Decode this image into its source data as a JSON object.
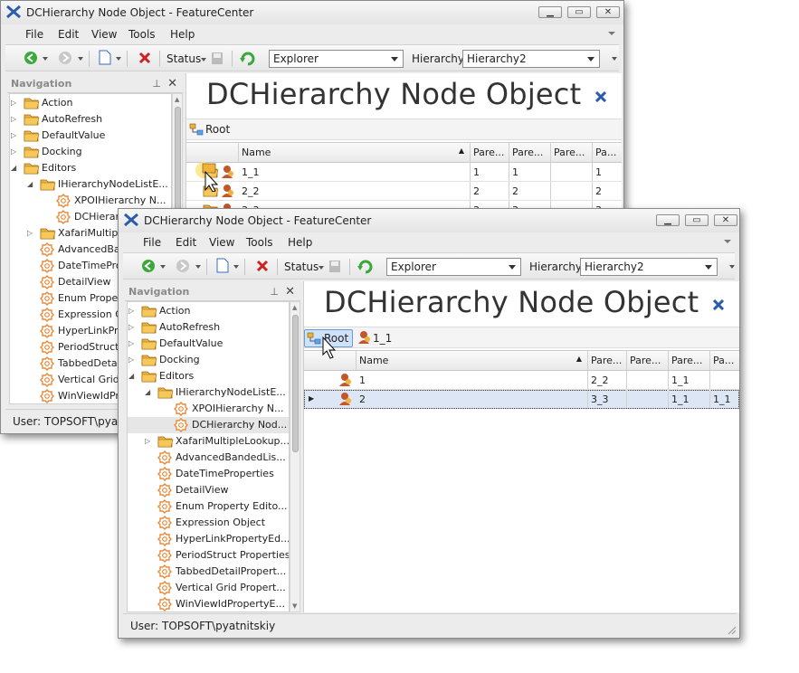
{
  "back_window": {
    "title": "DCHierarchy Node Object - FeatureCenter",
    "menu": [
      "File",
      "Edit",
      "View",
      "Tools",
      "Help"
    ],
    "toolbar": {
      "status_label": "Status",
      "view_combo": "Explorer",
      "hierarchy_label": "Hierarchy",
      "hierarchy_combo": "Hierarchy2"
    },
    "navigation": {
      "title": "Navigation",
      "items": [
        {
          "label": "Action",
          "level": 0,
          "icon": "folder-icon",
          "expander": "collapsed"
        },
        {
          "label": "AutoRefresh",
          "level": 0,
          "icon": "folder-icon",
          "expander": "collapsed"
        },
        {
          "label": "DefaultValue",
          "level": 0,
          "icon": "folder-icon",
          "expander": "collapsed"
        },
        {
          "label": "Docking",
          "level": 0,
          "icon": "folder-icon",
          "expander": "collapsed"
        },
        {
          "label": "Editors",
          "level": 0,
          "icon": "folder-icon",
          "expander": "expanded"
        },
        {
          "label": "IHierarchyNodeListE...",
          "level": 1,
          "icon": "folder-icon",
          "expander": "expanded"
        },
        {
          "label": "XPOIHierarchy N...",
          "level": 2,
          "icon": "gear-icon",
          "expander": ""
        },
        {
          "label": "DCHierarc",
          "level": 2,
          "icon": "gear-icon",
          "expander": ""
        },
        {
          "label": "XafariMultiple",
          "level": 1,
          "icon": "folder-icon",
          "expander": "collapsed"
        },
        {
          "label": "AdvancedBan",
          "level": 1,
          "icon": "gear-icon",
          "expander": ""
        },
        {
          "label": "DateTimeProp",
          "level": 1,
          "icon": "gear-icon",
          "expander": ""
        },
        {
          "label": "DetailView",
          "level": 1,
          "icon": "gear-icon",
          "expander": ""
        },
        {
          "label": "Enum Propert",
          "level": 1,
          "icon": "gear-icon",
          "expander": ""
        },
        {
          "label": "Expression O",
          "level": 1,
          "icon": "gear-icon",
          "expander": ""
        },
        {
          "label": "HyperLinkPro",
          "level": 1,
          "icon": "gear-icon",
          "expander": ""
        },
        {
          "label": "PeriodStruct P",
          "level": 1,
          "icon": "gear-icon",
          "expander": ""
        },
        {
          "label": "TabbedDetail",
          "level": 1,
          "icon": "gear-icon",
          "expander": ""
        },
        {
          "label": "Vertical Grid P",
          "level": 1,
          "icon": "gear-icon",
          "expander": ""
        },
        {
          "label": "WinViewIdPro",
          "level": 1,
          "icon": "gear-icon",
          "expander": ""
        }
      ]
    },
    "status_text": "User: TOPSOFT\\pyatn",
    "view_title": "DCHierarchy Node Object",
    "breadcrumb": [
      "Root"
    ],
    "grid": {
      "columns": [
        "Name",
        "Pare...",
        "Pare...",
        "Pare...",
        "Pa..."
      ],
      "rows": [
        {
          "name": "1_1",
          "c1": "1",
          "c2": "1",
          "c3": "",
          "c4": "1"
        },
        {
          "name": "2_2",
          "c1": "2",
          "c2": "2",
          "c3": "",
          "c4": "2"
        },
        {
          "name": "3_3",
          "c1": "3",
          "c2": "3",
          "c3": "",
          "c4": "3"
        }
      ]
    }
  },
  "front_window": {
    "title": "DCHierarchy Node Object - FeatureCenter",
    "menu": [
      "File",
      "Edit",
      "View",
      "Tools",
      "Help"
    ],
    "toolbar": {
      "status_label": "Status",
      "view_combo": "Explorer",
      "hierarchy_label": "Hierarchy",
      "hierarchy_combo": "Hierarchy2"
    },
    "navigation": {
      "title": "Navigation",
      "items": [
        {
          "label": "Action",
          "level": 0,
          "icon": "folder-icon",
          "expander": "collapsed"
        },
        {
          "label": "AutoRefresh",
          "level": 0,
          "icon": "folder-icon",
          "expander": "collapsed"
        },
        {
          "label": "DefaultValue",
          "level": 0,
          "icon": "folder-icon",
          "expander": "collapsed"
        },
        {
          "label": "Docking",
          "level": 0,
          "icon": "folder-icon",
          "expander": "collapsed"
        },
        {
          "label": "Editors",
          "level": 0,
          "icon": "folder-icon",
          "expander": "expanded"
        },
        {
          "label": "IHierarchyNodeListE...",
          "level": 1,
          "icon": "folder-icon",
          "expander": "expanded"
        },
        {
          "label": "XPOIHierarchy N...",
          "level": 2,
          "icon": "gear-icon",
          "expander": ""
        },
        {
          "label": "DCHierarchy Nod...",
          "level": 2,
          "icon": "gear-icon",
          "expander": "",
          "selected": true
        },
        {
          "label": "XafariMultipleLookup...",
          "level": 1,
          "icon": "folder-icon",
          "expander": "collapsed"
        },
        {
          "label": "AdvancedBandedLis...",
          "level": 1,
          "icon": "gear-icon",
          "expander": ""
        },
        {
          "label": "DateTimeProperties",
          "level": 1,
          "icon": "gear-icon",
          "expander": ""
        },
        {
          "label": "DetailView",
          "level": 1,
          "icon": "gear-icon",
          "expander": ""
        },
        {
          "label": "Enum Property Edito...",
          "level": 1,
          "icon": "gear-icon",
          "expander": ""
        },
        {
          "label": "Expression Object",
          "level": 1,
          "icon": "gear-icon",
          "expander": ""
        },
        {
          "label": "HyperLinkPropertyEd...",
          "level": 1,
          "icon": "gear-icon",
          "expander": ""
        },
        {
          "label": "PeriodStruct Properties",
          "level": 1,
          "icon": "gear-icon",
          "expander": ""
        },
        {
          "label": "TabbedDetailPropert...",
          "level": 1,
          "icon": "gear-icon",
          "expander": ""
        },
        {
          "label": "Vertical Grid Propert...",
          "level": 1,
          "icon": "gear-icon",
          "expander": ""
        },
        {
          "label": "WinViewIdPropertyE...",
          "level": 1,
          "icon": "gear-icon",
          "expander": ""
        }
      ]
    },
    "status_text": "User: TOPSOFT\\pyatnitskiy",
    "view_title": "DCHierarchy Node Object",
    "breadcrumb": [
      "Root",
      "1_1"
    ],
    "grid": {
      "columns": [
        "Name",
        "Pare...",
        "Pare...",
        "Pare...",
        "Pa..."
      ],
      "rows": [
        {
          "name": "1",
          "c1": "2_2",
          "c2": "",
          "c3": "1_1",
          "c4": ""
        },
        {
          "name": "2",
          "c1": "3_3",
          "c2": "",
          "c3": "1_1",
          "c4": "1_1",
          "selected": true
        }
      ]
    }
  },
  "colors": {
    "folder": "#f0b23c",
    "gear": "#e98a3a",
    "accent_blue": "#2a5caa",
    "selection": "#dce6f4",
    "refresh_green": "#3aa83a",
    "delete_red": "#d02020"
  }
}
